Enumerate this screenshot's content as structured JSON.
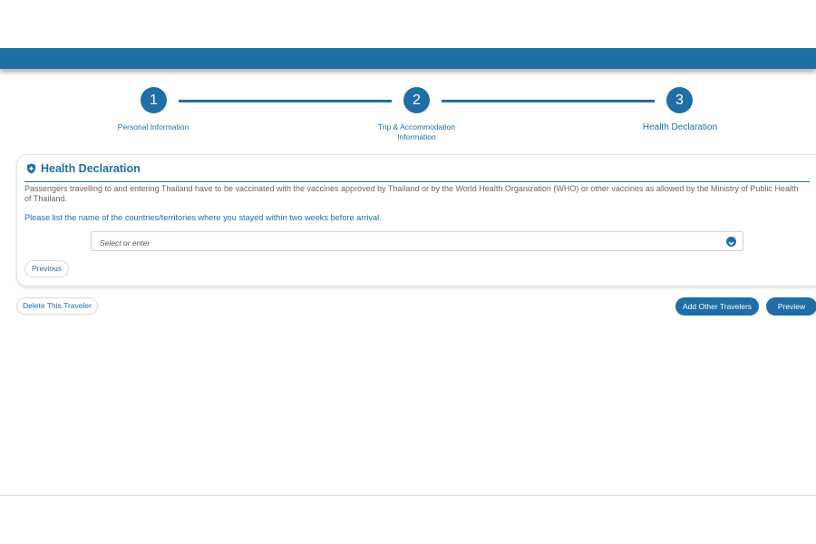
{
  "colors": {
    "primary": "#1f6ea6",
    "border": "#d6d9dd",
    "muted": "#666666"
  },
  "stepper": {
    "steps": [
      {
        "number": "1",
        "label": "Personal Information"
      },
      {
        "number": "2",
        "label_line1": "Trip & Accommodation",
        "label_line2": "Information"
      },
      {
        "number": "3",
        "label": "Health Declaration"
      }
    ]
  },
  "card": {
    "icon": "shield-icon",
    "title": "Health Declaration",
    "description": "Passengers travelling to and entering Thailand have to be vaccinated with the vaccines approved by Thailand or by the World Health Organization (WHO) or other vaccines as allowed by the Ministry of Public Health of Thailand.",
    "question": "Please list the name of the countries/territories where you stayed within two weeks before arrival.",
    "select": {
      "placeholder": "Select or enter",
      "icon": "chevron-down-icon"
    },
    "previous_label": "Previous"
  },
  "actions": {
    "delete_label": "Delete This Traveler",
    "add_label": "Add Other Travelers",
    "preview_label": "Preview"
  }
}
